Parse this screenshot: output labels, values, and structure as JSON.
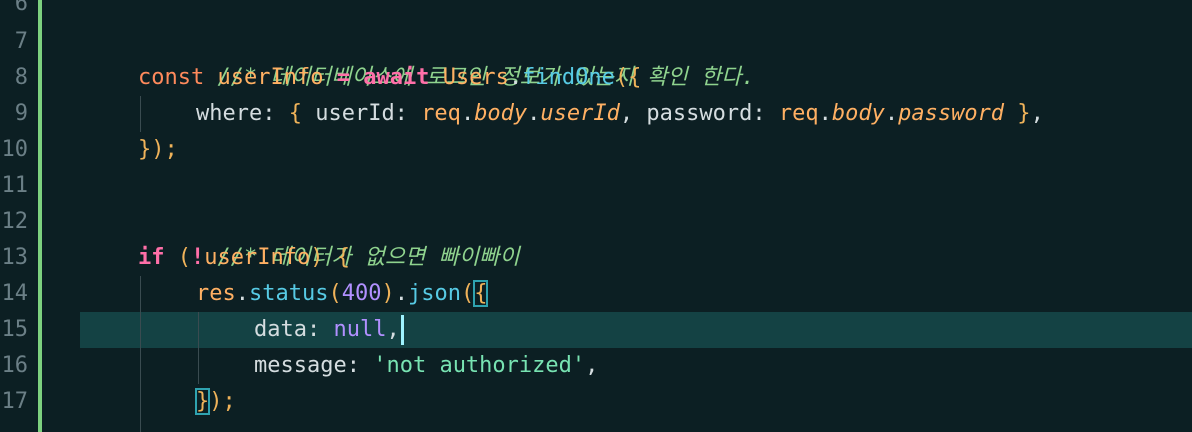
{
  "editor": {
    "line_numbers": [
      "6",
      "7",
      "8",
      "9",
      "10",
      "11",
      "12",
      "13",
      "14",
      "15",
      "16",
      "17"
    ],
    "current_line": "15",
    "lines": {
      "l7": {
        "comment": "//* 데이터베이스에 로그인 정보가 있는지 확인 한다."
      },
      "l8": {
        "const": "const",
        "name": "userInfo",
        "eq": " = ",
        "await": "await",
        "cls": "Users",
        "dot": ".",
        "fn": "findOne",
        "open": "({"
      },
      "l9": {
        "where": "where: ",
        "lb": "{",
        "k1": " userId: ",
        "req1": "req",
        "dot1": ".",
        "body1": "body",
        "dot2": ".",
        "prop1": "userId",
        "comma1": ", password: ",
        "req2": "req",
        "dot3": ".",
        "body2": "body",
        "dot4": ".",
        "prop2": "password",
        "rb": " }",
        "comma2": ","
      },
      "l10": {
        "close": "});"
      },
      "l12": {
        "comment": "//* 데이터가 없으면 빠이빠이"
      },
      "l13": {
        "if": "if",
        "open": " (",
        "not": "!",
        "name": "userInfo",
        "close": ") ",
        "brace": "{"
      },
      "l14": {
        "res": "res",
        "dot1": ".",
        "status": "status",
        "lp": "(",
        "num": "400",
        "rp": ")",
        "dot2": ".",
        "json": "json",
        "lp2": "(",
        "brace": "{"
      },
      "l15": {
        "key": "data: ",
        "val": "null",
        "comma": ","
      },
      "l16": {
        "key": "message: ",
        "val": "'not authorized'",
        "comma": ","
      },
      "l17": {
        "brace": "}",
        "close": ");"
      }
    }
  }
}
